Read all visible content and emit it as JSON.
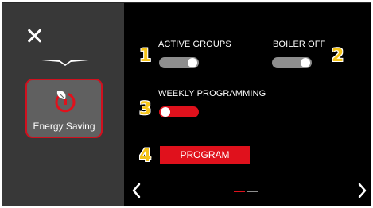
{
  "sidebar": {
    "close_icon": "close-icon",
    "mode_tile": {
      "label": "Energy Saving",
      "icon": "leaf-power-icon",
      "accent": "#d0101e"
    }
  },
  "settings": {
    "active_groups": {
      "badge": "1",
      "label": "ACTIVE GROUPS",
      "state": "on"
    },
    "boiler_off": {
      "badge": "2",
      "label": "BOILER OFF",
      "state": "on"
    },
    "weekly_programming": {
      "badge": "3",
      "label": "WEEKLY PROGRAMMING",
      "state": "off"
    },
    "program": {
      "badge": "4",
      "label": "PROGRAM"
    }
  },
  "pagination": {
    "current": 1,
    "total": 2
  },
  "colors": {
    "background": "#000000",
    "sidebar": "#383838",
    "accent_red": "#e0111c",
    "badge_yellow": "#f5c418"
  }
}
